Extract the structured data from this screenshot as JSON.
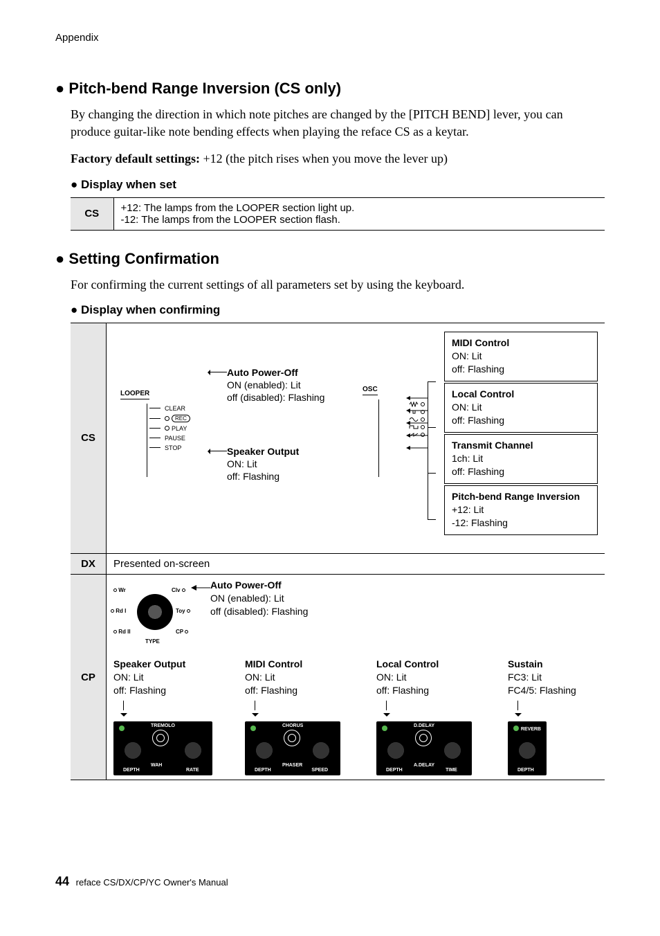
{
  "header": {
    "section": "Appendix"
  },
  "pitchbend": {
    "title": "Pitch-bend Range Inversion (CS only)",
    "body": "By changing the direction in which note pitches are changed by the [PITCH BEND] lever, you can produce guitar-like note bending effects when playing the reface CS as a keytar.",
    "factory_label": "Factory default settings:",
    "factory_value": " +12 (the pitch rises when you move the lever up)",
    "display_heading": "Display when set",
    "table": {
      "row_label": "CS",
      "line1": "+12: The lamps from the LOOPER section light up.",
      "line2": "-12:  The lamps from the LOOPER section flash."
    }
  },
  "setting": {
    "title": "Setting Confirmation",
    "body": "For confirming the current settings of all parameters set by using the keyboard.",
    "display_heading": "Display when confirming"
  },
  "cs": {
    "row_label": "CS",
    "looper": {
      "title": "LOOPER",
      "items": [
        "CLEAR",
        "REC",
        "PLAY",
        "PAUSE",
        "STOP"
      ]
    },
    "apo": {
      "head": "Auto Power-Off",
      "l1": "ON (enabled): Lit",
      "l2": "off (disabled): Flashing"
    },
    "spk": {
      "head": "Speaker Output",
      "l1": "ON: Lit",
      "l2": "off:  Flashing"
    },
    "osc": {
      "title": "OSC"
    },
    "boxes": {
      "midi": {
        "head": "MIDI Control",
        "l1": "ON: Lit",
        "l2": "off:  Flashing"
      },
      "local": {
        "head": "Local Control",
        "l1": "ON: Lit",
        "l2": "off:  Flashing"
      },
      "tx": {
        "head": "Transmit Channel",
        "l1": "1ch: Lit",
        "l2": "off:  Flashing"
      },
      "pbi": {
        "head": "Pitch-bend Range Inversion",
        "l1": "+12: Lit",
        "l2": "-12: Flashing"
      }
    }
  },
  "dx": {
    "row_label": "DX",
    "text": "Presented on-screen"
  },
  "cp": {
    "row_label": "CP",
    "type_labels": {
      "wr": "Wr",
      "clv": "Clv",
      "rdI_l": "Rd I",
      "toy": "Toy",
      "rdII": "Rd II",
      "cp": "CP",
      "type": "TYPE"
    },
    "apo": {
      "head": "Auto Power-Off",
      "l1": "ON (enabled): Lit",
      "l2": "off (disabled): Flashing"
    },
    "cols": {
      "spk": {
        "head": "Speaker Output",
        "l1": "ON: Lit",
        "l2": "off:  Flashing"
      },
      "midi": {
        "head": "MIDI Control",
        "l1": "ON: Lit",
        "l2": "off:  Flashing"
      },
      "local": {
        "head": "Local Control",
        "l1": "ON: Lit",
        "l2": "off:  Flashing"
      },
      "sustain": {
        "head": "Sustain",
        "l1": "FC3:   Lit",
        "l2": "FC4/5: Flashing"
      }
    },
    "dial_labels": {
      "tremolo": "TREMOLO",
      "wah": "WAH",
      "depth": "DEPTH",
      "rate": "RATE",
      "chorus": "CHORUS",
      "phaser": "PHASER",
      "speed": "SPEED",
      "ddelay": "D.DELAY",
      "adelay": "A.DELAY",
      "time": "TIME",
      "reverb": "REVERB"
    }
  },
  "footer": {
    "page": "44",
    "text": "reface CS/DX/CP/YC Owner's Manual"
  },
  "glyph": {
    "bullet": "●",
    "rec_dot": "●",
    "tled": "O"
  }
}
